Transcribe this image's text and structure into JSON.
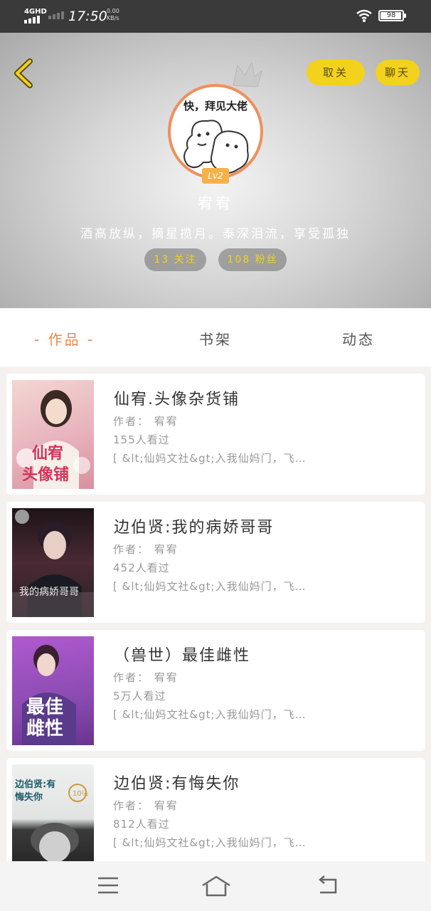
{
  "status_bar": {
    "network": "4GHD",
    "time": "17:50",
    "speed_value": "0.00",
    "speed_unit": "KB/s",
    "battery": "98"
  },
  "header": {
    "unfollow_label": "取关",
    "chat_label": "聊天",
    "avatar_text": "快，拜见大佬",
    "level": "Lv2",
    "username": "宥宥",
    "signature": "酒高放纵，摘星揽月。泰深泪流，享受孤独",
    "following": "13 关注",
    "fans": "108 粉丝"
  },
  "tabs": [
    {
      "label": "- 作品 -",
      "active": true
    },
    {
      "label": "书架",
      "active": false
    },
    {
      "label": "动态",
      "active": false
    }
  ],
  "books": [
    {
      "title": "仙宥.头像杂货铺",
      "author": "作者：  宥宥",
      "views": "155人看过",
      "desc": "[ &lt;仙妈文社&gt;入我仙妈门，飞…",
      "cover_text": "仙宥\n头像铺",
      "cover_color": "#e8b3bd"
    },
    {
      "title": "边伯贤:我的病娇哥哥",
      "author": "作者：  宥宥",
      "views": "452人看过",
      "desc": "[ &lt;仙妈文社&gt;入我仙妈门，飞…",
      "cover_text": "我的病娇哥哥",
      "cover_color": "#3a2a30"
    },
    {
      "title": "（兽世）最佳雌性",
      "author": "作者：  宥宥",
      "views": "5万人看过",
      "desc": "[ &lt;仙妈文社&gt;入我仙妈门，飞…",
      "cover_text": "最佳\n雌性",
      "cover_color": "#8a4bb0"
    },
    {
      "title": "边伯贤:有悔失你",
      "author": "作者：  宥宥",
      "views": "812人看过",
      "desc": "[ &lt;仙妈文社&gt;入我仙妈门，飞…",
      "cover_text": "边伯贤:有\n悔失你",
      "cover_color": "#e9ecec",
      "cover_badge": "10½"
    }
  ],
  "colors": {
    "accent": "#e8874f",
    "button_yellow": "#f2d21c",
    "level_badge": "#f5b24a"
  },
  "icons": {
    "back": "chevron-left-icon",
    "menu": "menu-icon",
    "home": "home-icon",
    "return": "return-icon"
  }
}
